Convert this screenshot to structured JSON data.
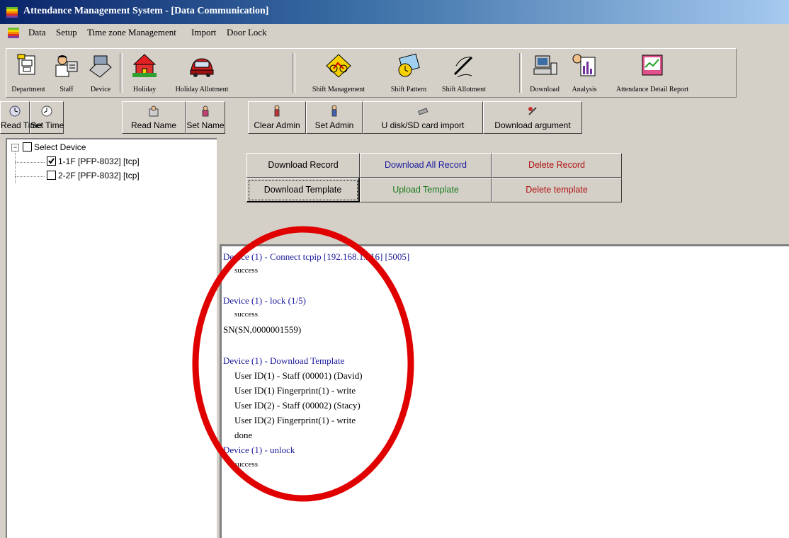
{
  "window": {
    "title": "Attendance Management System - [Data Communication]"
  },
  "menu": [
    "Data",
    "Setup",
    "Time zone Management",
    "Import",
    "Door Lock"
  ],
  "toolbar_main": [
    {
      "label": "Department",
      "icon": "department-icon"
    },
    {
      "label": "Staff",
      "icon": "staff-icon"
    },
    {
      "label": "Device",
      "icon": "device-icon"
    },
    {
      "label": "Holiday",
      "icon": "holiday-icon"
    },
    {
      "label": "Holiday Allotment",
      "icon": "holiday-allotment-icon"
    },
    {
      "label": "Shift Management",
      "icon": "shift-management-icon"
    },
    {
      "label": "Shift Pattern",
      "icon": "shift-pattern-icon"
    },
    {
      "label": "Shift Allotment",
      "icon": "shift-allotment-icon"
    },
    {
      "label": "Download",
      "icon": "download-icon"
    },
    {
      "label": "Analysis",
      "icon": "analysis-icon"
    },
    {
      "label": "Attendance Detail Report",
      "icon": "report-icon"
    }
  ],
  "toolbar_device": [
    {
      "label": "Read Time",
      "icon": "clock-icon"
    },
    {
      "label": "Set Time",
      "icon": "clock-set-icon"
    },
    {
      "label": "Read Name",
      "icon": "read-name-icon"
    },
    {
      "label": "Set Name",
      "icon": "set-name-icon"
    },
    {
      "label": "Clear Admin",
      "icon": "clear-admin-icon"
    },
    {
      "label": "Set Admin",
      "icon": "set-admin-icon"
    },
    {
      "label": "U disk/SD card import",
      "icon": "usb-disk-icon"
    },
    {
      "label": "Download argument",
      "icon": "download-argument-icon"
    }
  ],
  "device_tree": {
    "root": {
      "label": "Select Device",
      "checked": false
    },
    "devices": [
      {
        "label": "1-1F  [PFP-8032]  [tcp]",
        "checked": true
      },
      {
        "label": "2-2F  [PFP-8032]  [tcp]",
        "checked": false
      }
    ]
  },
  "actions": {
    "download_record": "Download Record",
    "download_all_record": "Download All Record",
    "delete_record": "Delete Record",
    "download_template": "Download Template",
    "upload_template": "Upload Template",
    "delete_template": "Delete template"
  },
  "log": [
    {
      "text": "Device (1) - Connect tcpip    [192.168.1.216]    [5005]",
      "style": "blue"
    },
    {
      "text": "success",
      "style": "small-indent"
    },
    {
      "text": "Device (1) - lock (1/5)",
      "style": "blue"
    },
    {
      "text": "success",
      "style": "small-indent"
    },
    {
      "text": "SN(SN,0000001559)",
      "style": "plain"
    },
    {
      "text": "Device (1) - Download Template",
      "style": "blue"
    },
    {
      "text": "User ID(1) - Staff (00001) (David)",
      "style": "indent"
    },
    {
      "text": "User ID(1)  Fingerprint(1) - write",
      "style": "indent"
    },
    {
      "text": "User ID(2) - Staff (00002) (Stacy)",
      "style": "indent"
    },
    {
      "text": "User ID(2)  Fingerprint(1) - write",
      "style": "indent"
    },
    {
      "text": "done",
      "style": "indent"
    },
    {
      "text": "Device (1) - unlock",
      "style": "blue"
    },
    {
      "text": "success",
      "style": "small-indent"
    }
  ],
  "colors": {
    "titlebar": "#0a246a",
    "log_blue": "#1a1a9c",
    "upload_green": "#1a7a1a",
    "delete_red": "#b01010",
    "annotation": "#e00000"
  }
}
